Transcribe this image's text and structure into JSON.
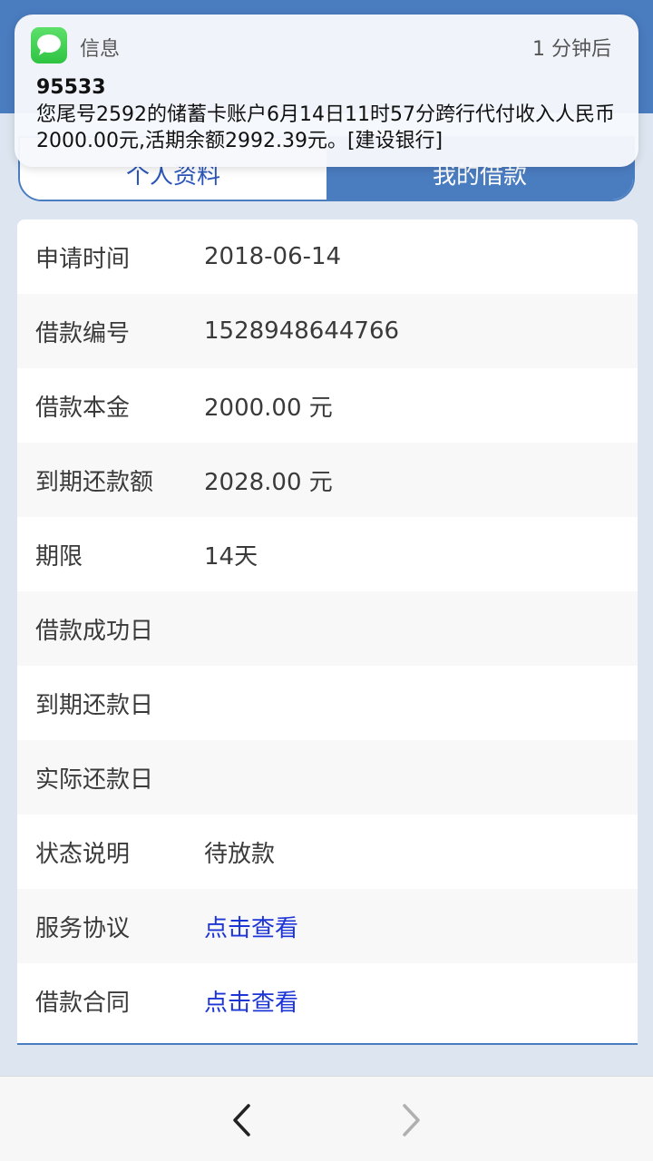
{
  "tabs": {
    "left": "个人资料",
    "right": "我的借款"
  },
  "notification": {
    "app_name": "信息",
    "time": "1 分钟后",
    "sender": "95533",
    "body": "您尾号2592的储蓄卡账户6月14日11时57分跨行代付收入人民币2000.00元,活期余额2992.39元。[建设银行]"
  },
  "loan": {
    "rows": [
      {
        "label": "申请时间",
        "value": "2018-06-14"
      },
      {
        "label": "借款编号",
        "value": "1528948644766"
      },
      {
        "label": "借款本金",
        "value": "2000.00 元"
      },
      {
        "label": "到期还款额",
        "value": "2028.00 元"
      },
      {
        "label": "期限",
        "value": "14天"
      },
      {
        "label": "借款成功日",
        "value": ""
      },
      {
        "label": "到期还款日",
        "value": ""
      },
      {
        "label": "实际还款日",
        "value": ""
      },
      {
        "label": "状态说明",
        "value": "待放款"
      },
      {
        "label": "服务协议",
        "value": "点击查看"
      },
      {
        "label": "借款合同",
        "value": "点击查看"
      }
    ]
  },
  "colors": {
    "accent": "#4a7cc0",
    "link": "#1d35d6",
    "background": "#dde6f0"
  },
  "icons": {
    "app": "messages-icon",
    "back": "chevron-left-icon",
    "forward": "chevron-right-icon"
  }
}
